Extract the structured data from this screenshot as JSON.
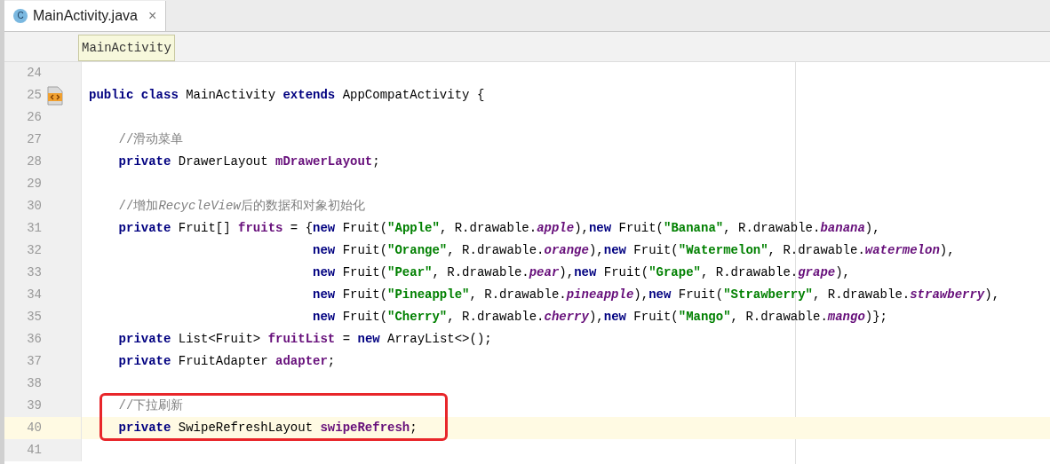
{
  "tabs": [
    {
      "icon": "C",
      "label": "MainActivity.java",
      "close": "×",
      "selected": true
    }
  ],
  "breadcrumb": "MainActivity",
  "lines": [
    {
      "number": "24",
      "current": false,
      "framed": false
    },
    {
      "number": "25",
      "current": false,
      "framed": false,
      "gutter_icon": true,
      "kind": "class",
      "tokens": [
        {
          "kind": "kw",
          "t": "public class "
        },
        {
          "kind": "plain",
          "t": "MainActivity "
        },
        {
          "kind": "kw",
          "t": "extends "
        },
        {
          "kind": "plain",
          "t": "AppCompatActivity {"
        }
      ]
    },
    {
      "number": "26",
      "current": false,
      "framed": false
    },
    {
      "number": "27",
      "current": false,
      "framed": false,
      "kind": "member",
      "tokens": [
        {
          "kind": "comment",
          "t": "//滑动菜单"
        }
      ]
    },
    {
      "number": "28",
      "current": false,
      "framed": false,
      "kind": "member",
      "tokens": [
        {
          "kind": "kw",
          "t": "private "
        },
        {
          "kind": "plain",
          "t": "DrawerLayout "
        },
        {
          "kind": "field",
          "t": "mDrawerLayout"
        },
        {
          "kind": "plain",
          "t": ";"
        }
      ]
    },
    {
      "number": "29",
      "current": false,
      "framed": false
    },
    {
      "number": "30",
      "current": false,
      "framed": false,
      "kind": "member",
      "tokens": [
        {
          "kind": "comment",
          "t": "//增加"
        },
        {
          "kind": "comment_italic",
          "t": "RecycleView"
        },
        {
          "kind": "comment",
          "t": "后的数据和对象初始化"
        }
      ]
    },
    {
      "number": "31",
      "current": false,
      "framed": false,
      "kind": "member",
      "tokens": [
        {
          "kind": "kw",
          "t": "private "
        },
        {
          "kind": "plain",
          "t": "Fruit[] "
        },
        {
          "kind": "field",
          "t": "fruits"
        },
        {
          "kind": "plain",
          "t": " = {"
        },
        {
          "kind": "kw",
          "t": "new "
        },
        {
          "kind": "plain",
          "t": "Fruit("
        },
        {
          "kind": "str",
          "t": "\"Apple\""
        },
        {
          "kind": "plain",
          "t": ", R.drawable."
        },
        {
          "kind": "static",
          "t": "apple"
        },
        {
          "kind": "plain",
          "t": "),"
        },
        {
          "kind": "kw",
          "t": "new "
        },
        {
          "kind": "plain",
          "t": "Fruit("
        },
        {
          "kind": "str",
          "t": "\"Banana\""
        },
        {
          "kind": "plain",
          "t": ", R.drawable."
        },
        {
          "kind": "static",
          "t": "banana"
        },
        {
          "kind": "plain",
          "t": "),"
        }
      ]
    },
    {
      "number": "32",
      "current": false,
      "framed": false,
      "kind": "continuation",
      "tokens": [
        {
          "kind": "kw",
          "t": "new "
        },
        {
          "kind": "plain",
          "t": "Fruit("
        },
        {
          "kind": "str",
          "t": "\"Orange\""
        },
        {
          "kind": "plain",
          "t": ", R.drawable."
        },
        {
          "kind": "static",
          "t": "orange"
        },
        {
          "kind": "plain",
          "t": "),"
        },
        {
          "kind": "kw",
          "t": "new "
        },
        {
          "kind": "plain",
          "t": "Fruit("
        },
        {
          "kind": "str",
          "t": "\"Watermelon\""
        },
        {
          "kind": "plain",
          "t": ", R.drawable."
        },
        {
          "kind": "static",
          "t": "watermelon"
        },
        {
          "kind": "plain",
          "t": "),"
        }
      ]
    },
    {
      "number": "33",
      "current": false,
      "framed": false,
      "kind": "continuation",
      "tokens": [
        {
          "kind": "kw",
          "t": "new "
        },
        {
          "kind": "plain",
          "t": "Fruit("
        },
        {
          "kind": "str",
          "t": "\"Pear\""
        },
        {
          "kind": "plain",
          "t": ", R.drawable."
        },
        {
          "kind": "static",
          "t": "pear"
        },
        {
          "kind": "plain",
          "t": "),"
        },
        {
          "kind": "kw",
          "t": "new "
        },
        {
          "kind": "plain",
          "t": "Fruit("
        },
        {
          "kind": "str",
          "t": "\"Grape\""
        },
        {
          "kind": "plain",
          "t": ", R.drawable."
        },
        {
          "kind": "static",
          "t": "grape"
        },
        {
          "kind": "plain",
          "t": "),"
        }
      ]
    },
    {
      "number": "34",
      "current": false,
      "framed": false,
      "kind": "continuation",
      "tokens": [
        {
          "kind": "kw",
          "t": "new "
        },
        {
          "kind": "plain",
          "t": "Fruit("
        },
        {
          "kind": "str",
          "t": "\"Pineapple\""
        },
        {
          "kind": "plain",
          "t": ", R.drawable."
        },
        {
          "kind": "static",
          "t": "pineapple"
        },
        {
          "kind": "plain",
          "t": "),"
        },
        {
          "kind": "kw",
          "t": "new "
        },
        {
          "kind": "plain",
          "t": "Fruit("
        },
        {
          "kind": "str",
          "t": "\"Strawberry\""
        },
        {
          "kind": "plain",
          "t": ", R.drawable."
        },
        {
          "kind": "static",
          "t": "strawberry"
        },
        {
          "kind": "plain",
          "t": "),"
        }
      ]
    },
    {
      "number": "35",
      "current": false,
      "framed": false,
      "kind": "continuation",
      "tokens": [
        {
          "kind": "kw",
          "t": "new "
        },
        {
          "kind": "plain",
          "t": "Fruit("
        },
        {
          "kind": "str",
          "t": "\"Cherry\""
        },
        {
          "kind": "plain",
          "t": ", R.drawable."
        },
        {
          "kind": "static",
          "t": "cherry"
        },
        {
          "kind": "plain",
          "t": "),"
        },
        {
          "kind": "kw",
          "t": "new "
        },
        {
          "kind": "plain",
          "t": "Fruit("
        },
        {
          "kind": "str",
          "t": "\"Mango\""
        },
        {
          "kind": "plain",
          "t": ", R.drawable."
        },
        {
          "kind": "static",
          "t": "mango"
        },
        {
          "kind": "plain",
          "t": ")};"
        }
      ]
    },
    {
      "number": "36",
      "current": false,
      "framed": false,
      "kind": "member",
      "tokens": [
        {
          "kind": "kw",
          "t": "private "
        },
        {
          "kind": "plain",
          "t": "List<Fruit> "
        },
        {
          "kind": "field",
          "t": "fruitList"
        },
        {
          "kind": "plain",
          "t": " = "
        },
        {
          "kind": "kw",
          "t": "new "
        },
        {
          "kind": "plain",
          "t": "ArrayList<>();"
        }
      ]
    },
    {
      "number": "37",
      "current": false,
      "framed": false,
      "kind": "member",
      "tokens": [
        {
          "kind": "kw",
          "t": "private "
        },
        {
          "kind": "plain",
          "t": "FruitAdapter "
        },
        {
          "kind": "field",
          "t": "adapter"
        },
        {
          "kind": "plain",
          "t": ";"
        }
      ]
    },
    {
      "number": "38",
      "current": false,
      "framed": false
    },
    {
      "number": "39",
      "current": false,
      "framed": true,
      "kind": "member",
      "tokens": [
        {
          "kind": "comment",
          "t": "//下拉刷新"
        }
      ]
    },
    {
      "number": "40",
      "current": true,
      "framed": true,
      "kind": "member",
      "tokens": [
        {
          "kind": "kw",
          "t": "private "
        },
        {
          "kind": "plain",
          "t": "SwipeRefreshLayout "
        },
        {
          "kind": "field",
          "t": "swipeRefresh"
        },
        {
          "kind": "plain",
          "t": ";"
        }
      ]
    },
    {
      "number": "41",
      "current": false,
      "framed": false
    }
  ]
}
